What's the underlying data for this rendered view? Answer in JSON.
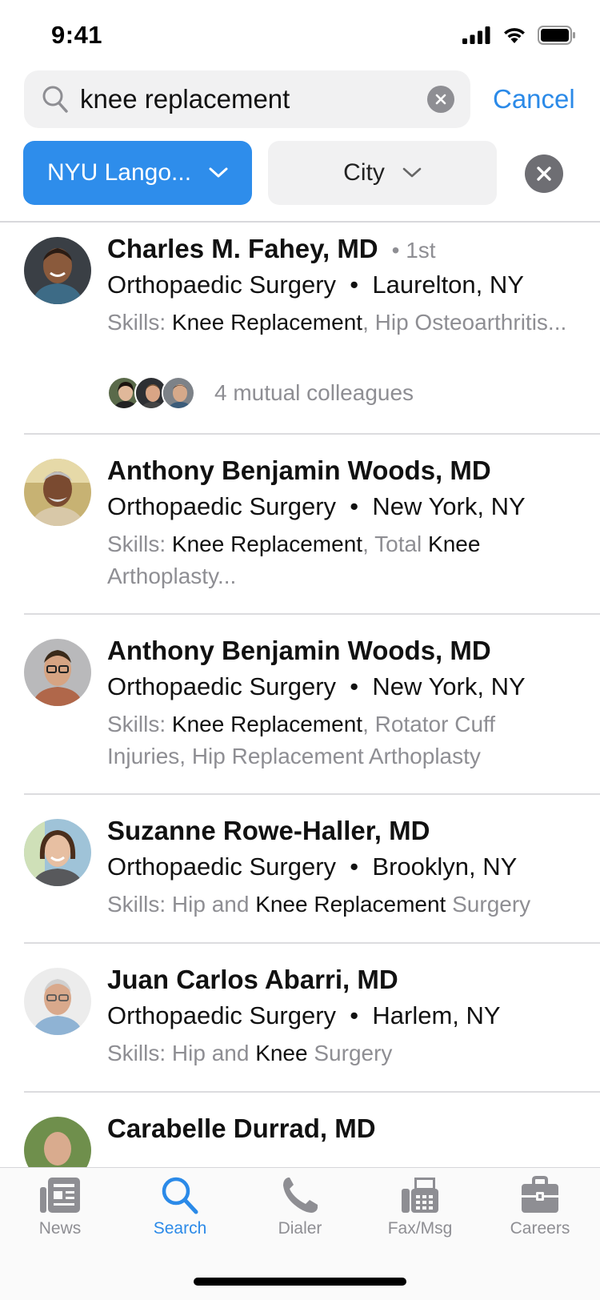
{
  "status_bar": {
    "time": "9:41"
  },
  "search": {
    "query": "knee replacement",
    "cancel_label": "Cancel"
  },
  "filters": {
    "organization": "NYU Lango...",
    "city": "City"
  },
  "results": [
    {
      "name": "Charles M. Fahey, MD",
      "degree": "1st",
      "specialty": "Orthopaedic Surgery",
      "location": "Laurelton, NY",
      "skills_prefix": "Skills:",
      "skills_highlight": "Knee Replacement",
      "skills_rest": ", Hip Osteoarthritis...",
      "mutual": "4 mutual colleagues"
    },
    {
      "name": "Anthony Benjamin Woods, MD",
      "specialty": "Orthopaedic Surgery",
      "location": "New York, NY",
      "skills_prefix": "Skills:",
      "skills_highlight": "Knee Replacement",
      "skills_rest": ", Total",
      "skills_highlight2": "Knee",
      "skills_rest2": "Arthoplasty..."
    },
    {
      "name": "Anthony Benjamin Woods, MD",
      "specialty": "Orthopaedic Surgery",
      "location": "New York, NY",
      "skills_prefix": "Skills:",
      "skills_highlight": "Knee Replacement",
      "skills_rest": ", Rotator Cuff Injuries, Hip Replacement Arthoplasty"
    },
    {
      "name": "Suzanne Rowe-Haller, MD",
      "specialty": "Orthopaedic Surgery",
      "location": "Brooklyn, NY",
      "skills_prefix": "Skills: Hip and",
      "skills_highlight": "Knee Replacement",
      "skills_rest": "Surgery"
    },
    {
      "name": "Juan Carlos Abarri, MD",
      "specialty": "Orthopaedic Surgery",
      "location": "Harlem, NY",
      "skills_prefix": "Skills: Hip and",
      "skills_highlight": "Knee",
      "skills_rest": "Surgery"
    },
    {
      "name": "Carabelle Durrad, MD"
    }
  ],
  "tabs": [
    {
      "label": "News",
      "icon": "news-icon"
    },
    {
      "label": "Search",
      "icon": "search-icon",
      "active": true
    },
    {
      "label": "Dialer",
      "icon": "phone-icon"
    },
    {
      "label": "Fax/Msg",
      "icon": "fax-icon"
    },
    {
      "label": "Careers",
      "icon": "briefcase-icon"
    }
  ],
  "colors": {
    "accent": "#2b8ae8",
    "chip_active": "#2e8deb",
    "muted": "#8e8e93"
  }
}
